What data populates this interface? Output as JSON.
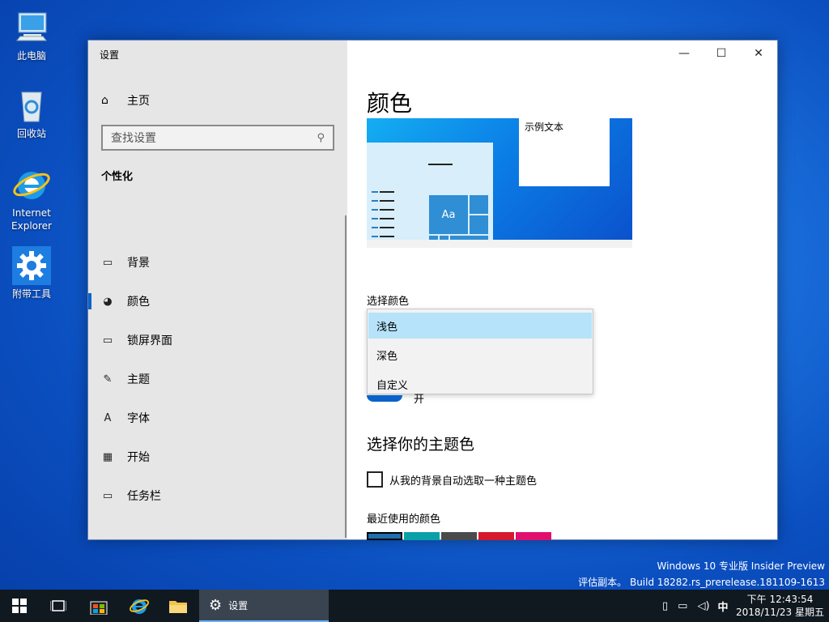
{
  "desktop": {
    "icons": [
      {
        "label": "此电脑",
        "icon": "computer-icon"
      },
      {
        "label": "回收站",
        "icon": "recycle-bin-icon"
      },
      {
        "label_line1": "Internet",
        "label_line2": "Explorer",
        "icon": "ie-icon"
      },
      {
        "label": "附带工具",
        "icon": "gear-icon"
      }
    ],
    "watermark": {
      "line1": "Windows 10 专业版 Insider Preview",
      "line2": "评估副本。 Build 18282.rs_prerelease.181109-1613"
    }
  },
  "window": {
    "title": "设置",
    "controls": {
      "minimize": "—",
      "maximize": "☐",
      "close": "✕"
    },
    "nav": {
      "home_label": "主页",
      "search_placeholder": "查找设置",
      "section_title": "个性化",
      "items": [
        {
          "label": "背景",
          "icon": "picture-icon",
          "glyph": "▭"
        },
        {
          "label": "颜色",
          "icon": "palette-icon",
          "glyph": "◕",
          "selected": true
        },
        {
          "label": "锁屏界面",
          "icon": "lock-screen-icon",
          "glyph": "▭"
        },
        {
          "label": "主题",
          "icon": "theme-brush-icon",
          "glyph": "✎"
        },
        {
          "label": "字体",
          "icon": "font-icon",
          "glyph": "A"
        },
        {
          "label": "开始",
          "icon": "start-grid-icon",
          "glyph": "▦"
        },
        {
          "label": "任务栏",
          "icon": "taskbar-icon",
          "glyph": "▭"
        }
      ]
    },
    "content": {
      "heading": "颜色",
      "preview_sample_text": "示例文本",
      "preview_tile_text": "Aa",
      "choose_color_label": "选择颜色",
      "dropdown_options": [
        "浅色",
        "深色",
        "自定义"
      ],
      "dropdown_selected": "浅色",
      "toggle_partial_text": "开",
      "accent_heading": "选择你的主题色",
      "auto_pick_label": "从我的背景自动选取一种主题色",
      "recent_colors_label": "最近使用的颜色",
      "recent_colors": [
        "#1f6fae",
        "#0aa0a8",
        "#4a4a4a",
        "#d41a2c",
        "#e0106e"
      ]
    }
  },
  "taskbar": {
    "active_app_label": "设置",
    "tray_ime": "中",
    "clock_time": "下午 12:43:54",
    "clock_date": "2018/11/23 星期五"
  },
  "colors": {
    "accent": "#0a63c9",
    "taskbar": "#101820"
  }
}
